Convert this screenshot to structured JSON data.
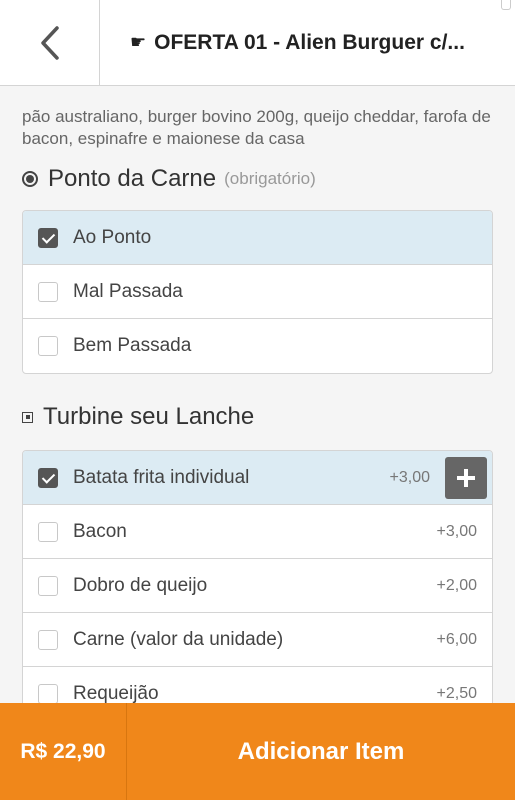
{
  "header": {
    "back_icon": "chevron-left-icon",
    "title_icon": "pointing-hand-icon",
    "title": "OFERTA 01 - Alien Burguer c/..."
  },
  "description": "pão australiano, burger bovino 200g, queijo cheddar, farofa de bacon, espinafre e maionese da casa",
  "groups": [
    {
      "title": "Ponto da Carne",
      "required": "(obrigatório)",
      "items": [
        {
          "label": "Ao Ponto",
          "checked": true
        },
        {
          "label": "Mal Passada",
          "checked": false
        },
        {
          "label": "Bem Passada",
          "checked": false
        }
      ]
    },
    {
      "title": "Turbine seu Lanche",
      "items": [
        {
          "label": "Batata frita individual",
          "price": "+3,00",
          "checked": true
        },
        {
          "label": "Bacon",
          "price": "+3,00",
          "checked": false
        },
        {
          "label": "Dobro de queijo",
          "price": "+2,00",
          "checked": false
        },
        {
          "label": "Carne (valor da unidade)",
          "price": "+6,00",
          "checked": false
        },
        {
          "label": "Requeijão",
          "price": "+2,50",
          "checked": false
        }
      ]
    }
  ],
  "footer": {
    "total": "R$ 22,90",
    "add_label": "Adicionar Item"
  },
  "colors": {
    "accent": "#f0871a",
    "selected_row": "#dcebf3"
  }
}
